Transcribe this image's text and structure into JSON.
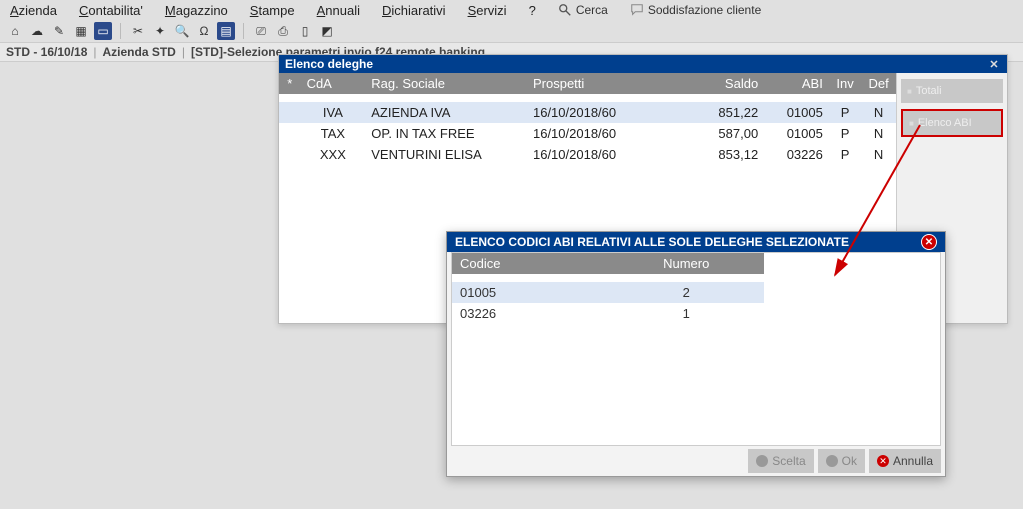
{
  "menu": {
    "azienda": "Azienda",
    "contabilita": "Contabilita'",
    "magazzino": "Magazzino",
    "stampe": "Stampe",
    "annuali": "Annuali",
    "dichiarativi": "Dichiarativi",
    "servizi": "Servizi",
    "help": "?",
    "cerca": "Cerca",
    "soddisfazione": "Soddisfazione cliente"
  },
  "breadcrumb": {
    "part1": "STD - 16/10/18",
    "part2": "Azienda STD",
    "part3": "[STD]-Selezione parametri invio f24 remote banking"
  },
  "deleghe": {
    "title": "Elenco deleghe",
    "headers": {
      "marker": "*",
      "cda": "CdA",
      "rag": "Rag. Sociale",
      "prospetti": "Prospetti",
      "saldo": "Saldo",
      "abi": "ABI",
      "inv": "Inv",
      "def": "Def"
    },
    "rows": [
      {
        "cda": "IVA",
        "rag": "AZIENDA IVA",
        "prospetti": "16/10/2018/60",
        "saldo": "851,22",
        "abi": "01005",
        "inv": "P",
        "def": "N"
      },
      {
        "cda": "TAX",
        "rag": "OP. IN TAX FREE",
        "prospetti": "16/10/2018/60",
        "saldo": "587,00",
        "abi": "01005",
        "inv": "P",
        "def": "N"
      },
      {
        "cda": "XXX",
        "rag": "VENTURINI ELISA",
        "prospetti": "16/10/2018/60",
        "saldo": "853,12",
        "abi": "03226",
        "inv": "P",
        "def": "N"
      }
    ],
    "side": {
      "totali": "Totali",
      "elenco_abi": "Elenco ABI"
    }
  },
  "popup": {
    "title": "ELENCO CODICI ABI RELATIVI ALLE SOLE DELEGHE SELEZIONATE",
    "headers": {
      "codice": "Codice",
      "numero": "Numero"
    },
    "rows": [
      {
        "codice": "01005",
        "numero": "2"
      },
      {
        "codice": "03226",
        "numero": "1"
      }
    ],
    "buttons": {
      "scelta": "Scelta",
      "ok": "Ok",
      "annulla": "Annulla"
    }
  }
}
